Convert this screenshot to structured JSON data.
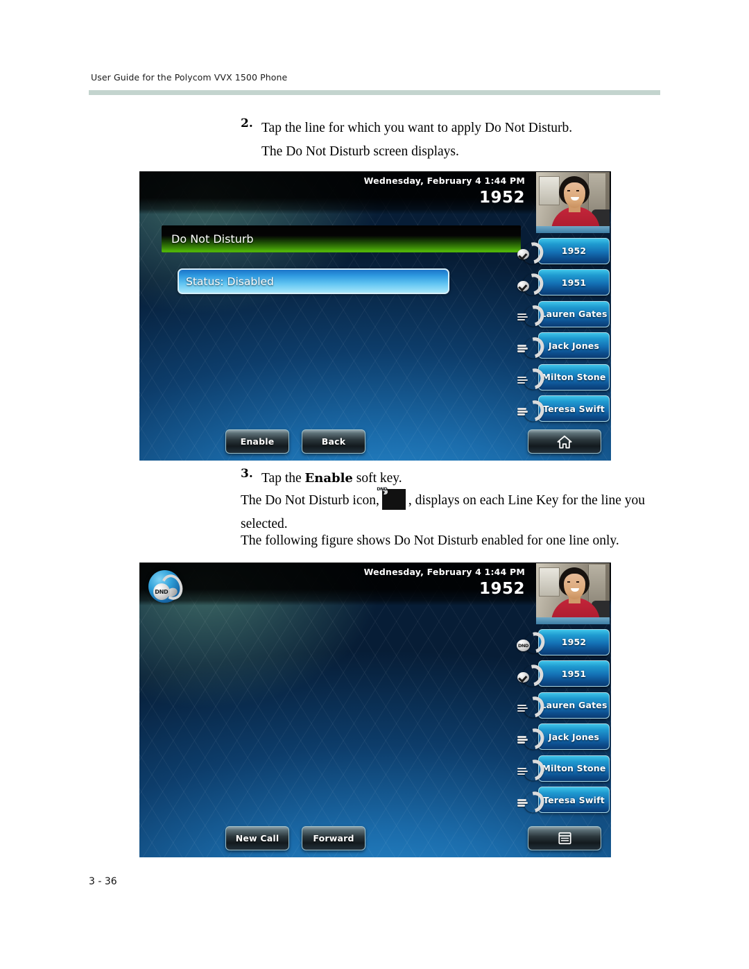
{
  "page": {
    "header": "User Guide for the Polycom VVX 1500 Phone",
    "footer": "3 - 36"
  },
  "steps": [
    {
      "number": "2.",
      "text": "Tap the line for which you want to apply Do Not Disturb.",
      "followup": "The Do Not Disturb screen displays."
    },
    {
      "number": "3.",
      "text_before_bold": "Tap the ",
      "bold": "Enable",
      "text_after_bold": " soft key."
    }
  ],
  "paragraphs": {
    "dnd_icon_sentence_before": "The Do Not Disturb icon,",
    "dnd_icon_sentence_after": ", displays on each Line Key for the line you selected.",
    "following_figure": "The following figure shows Do Not Disturb enabled for one line only."
  },
  "icons": {
    "dnd_label": "DND",
    "inline_dnd": "dnd-icon",
    "home": "home-icon",
    "page_list": "page-list-icon",
    "registered_line": "handset-check-icon",
    "blf_line": "handset-lines-icon",
    "dnd_line": "handset-dnd-icon"
  },
  "screen1": {
    "status": {
      "datetime": "Wednesday, February 4  1:44 PM",
      "extension": "1952"
    },
    "menu_title": "Do Not Disturb",
    "selected_row": "Status: Disabled",
    "line_keys": [
      {
        "label": "1952",
        "icon": "registered_line"
      },
      {
        "label": "1951",
        "icon": "registered_line"
      },
      {
        "label": "Lauren Gates",
        "icon": "blf_line"
      },
      {
        "label": "Jack Jones",
        "icon": "blf_line"
      },
      {
        "label": "Milton Stone",
        "icon": "blf_line"
      },
      {
        "label": "Teresa Swift",
        "icon": "blf_line"
      }
    ],
    "softkeys": [
      {
        "label": "Enable"
      },
      {
        "label": "Back"
      }
    ],
    "right_softkey_icon": "home"
  },
  "screen2": {
    "status": {
      "datetime": "Wednesday, February 4  1:44 PM",
      "extension": "1952"
    },
    "dnd_badge": "DND",
    "line_keys": [
      {
        "label": "1952",
        "icon": "dnd_line"
      },
      {
        "label": "1951",
        "icon": "registered_line"
      },
      {
        "label": "Lauren Gates",
        "icon": "blf_line"
      },
      {
        "label": "Jack Jones",
        "icon": "blf_line"
      },
      {
        "label": "Milton Stone",
        "icon": "blf_line"
      },
      {
        "label": "Teresa Swift",
        "icon": "blf_line"
      }
    ],
    "softkeys": [
      {
        "label": "New Call"
      },
      {
        "label": "Forward"
      }
    ],
    "right_softkey_icon": "page_list"
  },
  "colors": {
    "header_rule": "#c3d4ce",
    "menu_bar_green": "#55bf09",
    "selected_row_blue": "#2f9ae0",
    "line_key_blue": "#1f9ad0"
  }
}
